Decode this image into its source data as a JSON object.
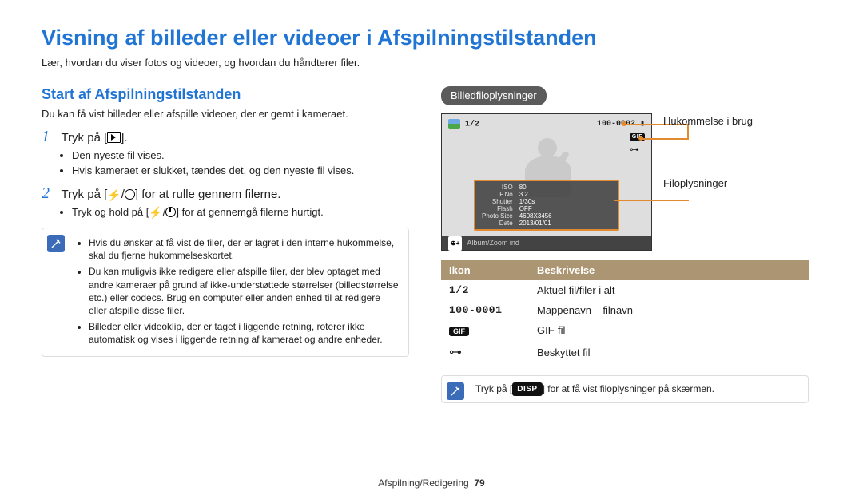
{
  "title": "Visning af billeder eller videoer i Afspilningstilstanden",
  "lead": "Lær, hvordan du viser fotos og videoer, og hvordan du håndterer filer.",
  "left": {
    "subhead": "Start af Afspilningstilstanden",
    "intro": "Du kan få vist billeder eller afspille videoer, der er gemt i kameraet.",
    "step1": {
      "num": "1",
      "pre": "Tryk på [",
      "post": "]."
    },
    "step1_bullets": [
      "Den nyeste fil vises.",
      "Hvis kameraet er slukket, tændes det, og den nyeste fil vises."
    ],
    "step2": {
      "num": "2",
      "pre": "Tryk på [",
      "sep": "/",
      "post": "] for at rulle gennem filerne."
    },
    "step2_bullets_pre": "Tryk og hold på [",
    "step2_bullets_sep": "/",
    "step2_bullets_post": "] for at gennemgå filerne hurtigt.",
    "note": [
      "Hvis du ønsker at få vist de filer, der er lagret i den interne hukommelse, skal du fjerne hukommelseskortet.",
      "Du kan muligvis ikke redigere eller afspille filer, der blev optaget med andre kameraer på grund af ikke-understøttede størrelser (billedstørrelse etc.) eller codecs. Brug en computer eller anden enhed til at redigere eller afspille disse filer.",
      "Billeder eller videoklip, der er taget i liggende retning, roterer ikke automatisk og vises i liggende retning af kameraet og andre enheder."
    ]
  },
  "right": {
    "pill": "Billedfiloplysninger",
    "callouts": {
      "mem": "Hukommelse i brug",
      "info": "Filoplysninger"
    },
    "screen": {
      "counter": "1/2",
      "folder": "100-0002",
      "details": {
        "ISO": "80",
        "F.No": "3.2",
        "Shutter": "1/30s",
        "Flash": "OFF",
        "Photo Size": "4608X3456",
        "Date": "2013/01/01"
      },
      "bottom_label": "Album/Zoom ind",
      "mag_label": "⊕+"
    },
    "table": {
      "head_icon": "Ikon",
      "head_desc": "Beskrivelse",
      "rows": [
        {
          "icon": "1/2",
          "kind": "mono",
          "desc": "Aktuel fil/filer i alt"
        },
        {
          "icon": "100-0001",
          "kind": "mono",
          "desc": "Mappenavn – filnavn"
        },
        {
          "icon": "GIF",
          "kind": "gif",
          "desc": "GIF-fil"
        },
        {
          "icon": "⊶",
          "kind": "key",
          "desc": "Beskyttet fil"
        }
      ]
    },
    "note_pre": "Tryk på [",
    "note_disp": "DISP",
    "note_post": "] for at få vist filoplysninger på skærmen."
  },
  "footer": {
    "section": "Afspilning/Redigering",
    "page": "79"
  }
}
